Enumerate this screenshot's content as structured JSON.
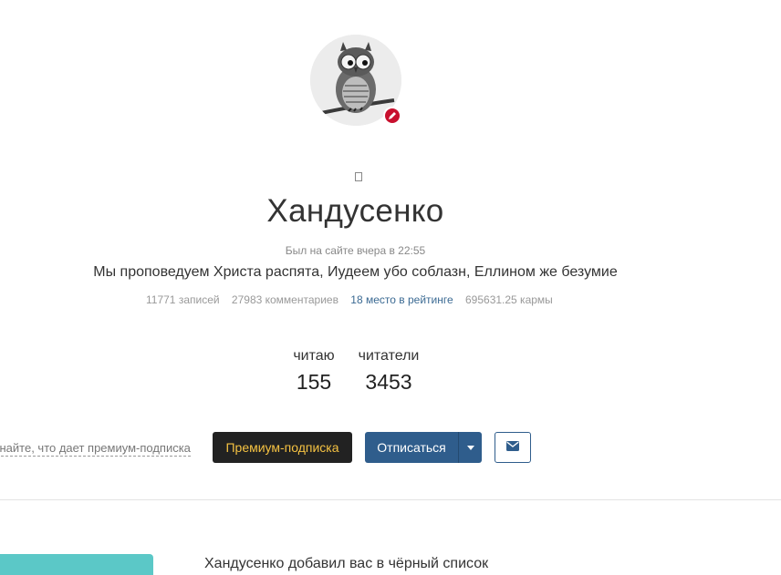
{
  "profile": {
    "name": "Хандусенко",
    "last_seen": "Был на сайте вчера в 22:55",
    "tagline": "Мы проповедуем Христа распята, Иудеем убо соблазн, Еллином же безумие",
    "avatar_icon": "owl-avatar-icon",
    "edit_icon": "pencil-icon"
  },
  "stats": {
    "posts": "11771 записей",
    "comments": "27983 комментариев",
    "rating": "18 место в рейтинге",
    "karma": "695631.25 кармы"
  },
  "follow": {
    "reading_label": "читаю",
    "reading_count": "155",
    "readers_label": "читатели",
    "readers_count": "3453"
  },
  "actions": {
    "premium_hint": "Узнайте, что дает премиум-подписка",
    "premium_button": "Премиум-подписка",
    "unsubscribe_button": "Отписаться",
    "message_icon": "envelope-icon"
  },
  "notice": {
    "blacklist": "Хандусенко добавил вас в чёрный список"
  },
  "colors": {
    "accent": "#2f5d8c",
    "premium_bg": "#222222",
    "premium_text": "#f5c242",
    "badge": "#c8102e",
    "teal": "#5bc8c7"
  }
}
